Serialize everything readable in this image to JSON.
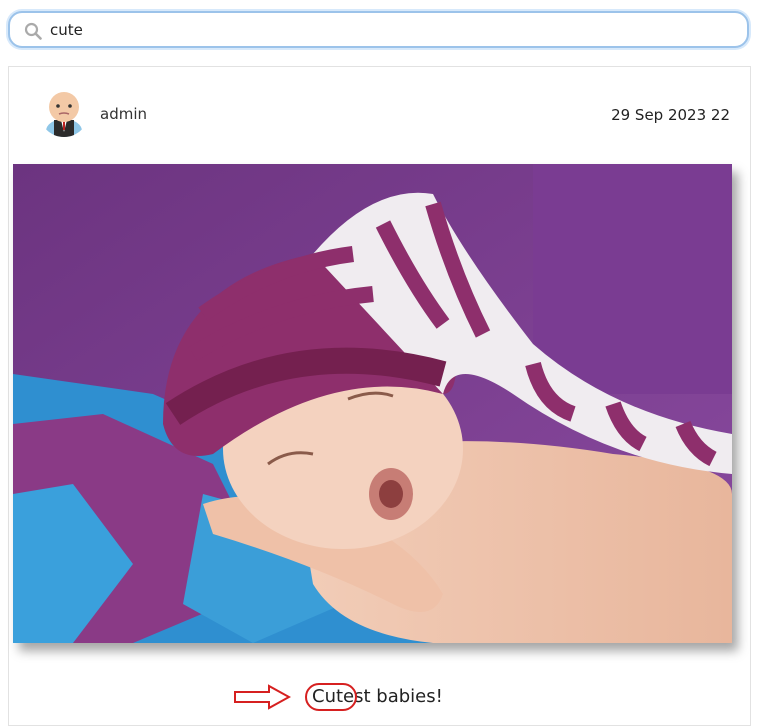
{
  "search": {
    "value": "cute",
    "icon": "search-icon"
  },
  "post": {
    "author": "admin",
    "date": "29 Sep 2023 22",
    "caption": "Cutest babies!",
    "image_alt_icon": "photo-sleeping-baby"
  },
  "colors": {
    "search_border": "#9cc3ea",
    "annotation_red": "#d62020",
    "photo_purple": "#7b3a8c"
  }
}
